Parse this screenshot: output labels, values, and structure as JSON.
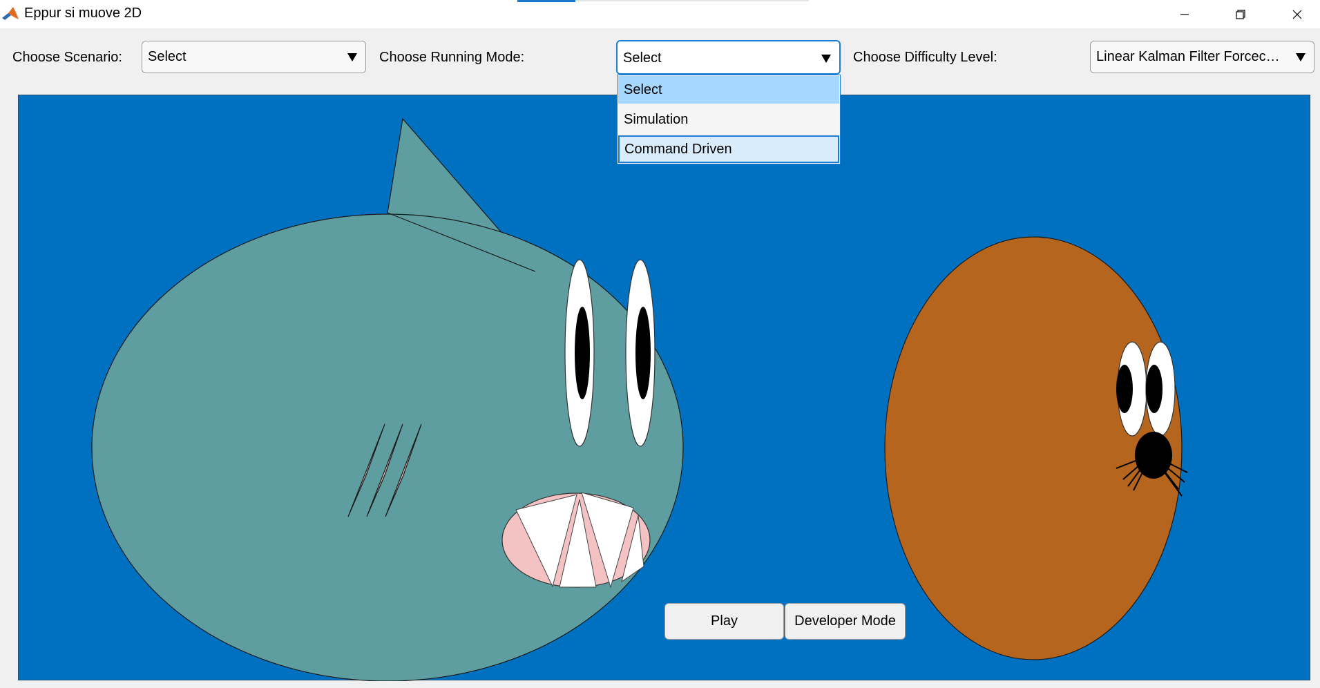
{
  "window": {
    "title": "Eppur si muove 2D",
    "controls": [
      "minimize",
      "restore",
      "close"
    ]
  },
  "toolbar": {
    "scenario_label": "Choose Scenario:",
    "scenario_value": "Select",
    "mode_label": "Choose Running Mode:",
    "mode_value": "Select",
    "difficulty_label": "Choose Difficulty Level:",
    "difficulty_value": "Linear Kalman Filter Forcecasting"
  },
  "mode_menu": {
    "items": [
      {
        "label": "Select",
        "state": "selected"
      },
      {
        "label": "Simulation",
        "state": "normal"
      },
      {
        "label": "Command Driven",
        "state": "hovered"
      }
    ]
  },
  "scene": {
    "background": "#0070c0",
    "shark_color": "#5f9ea0",
    "prey_color": "#b5651d",
    "mouth_color": "#f4c2c2"
  },
  "buttons": {
    "play": "Play",
    "developer_mode": "Developer Mode"
  }
}
